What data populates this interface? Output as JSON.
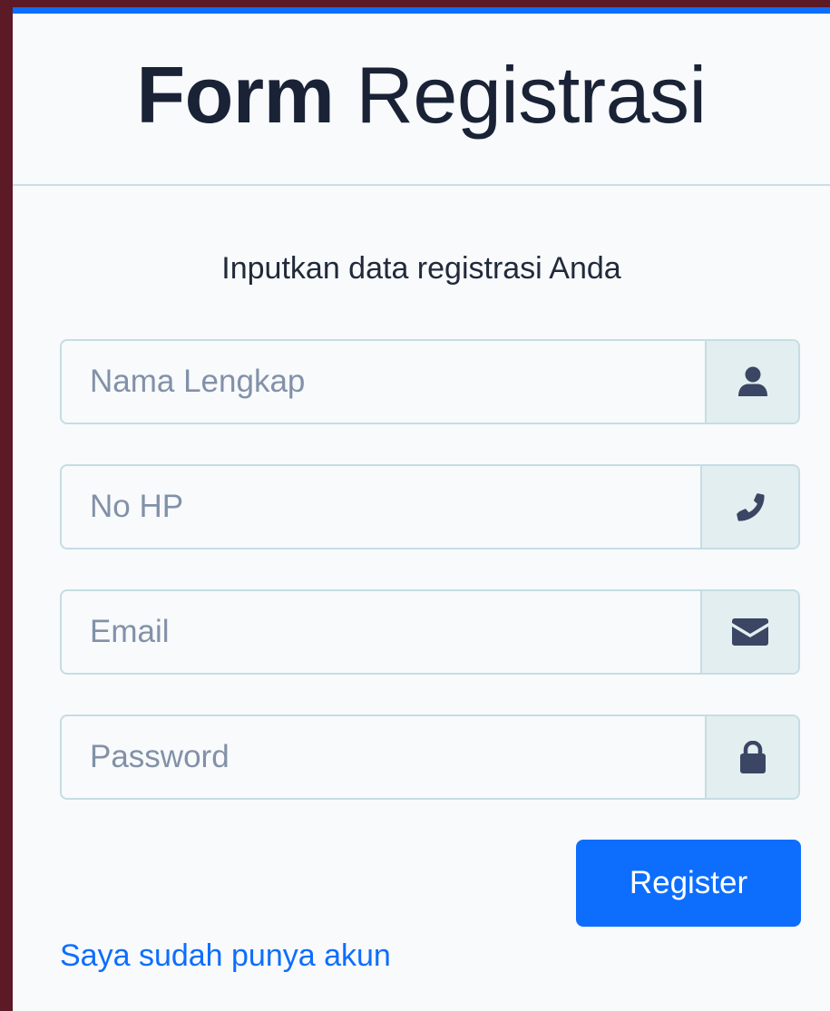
{
  "header": {
    "title_bold": "Form",
    "title_light": "Registrasi"
  },
  "form": {
    "subtitle": "Inputkan data registrasi Anda",
    "fields": [
      {
        "placeholder": "Nama Lengkap",
        "value": "",
        "icon": "user-icon"
      },
      {
        "placeholder": "No HP",
        "value": "",
        "icon": "phone-icon"
      },
      {
        "placeholder": "Email",
        "value": "",
        "icon": "envelope-icon"
      },
      {
        "placeholder": "Password",
        "value": "",
        "icon": "lock-icon"
      }
    ],
    "submit_label": "Register",
    "login_link": "Saya sudah punya akun"
  },
  "colors": {
    "background": "#5b1a26",
    "card": "#f8fafc",
    "accent": "#0d6efd",
    "title": "#1a2236",
    "addon": "#e3eef1",
    "icon": "#3a4663"
  }
}
